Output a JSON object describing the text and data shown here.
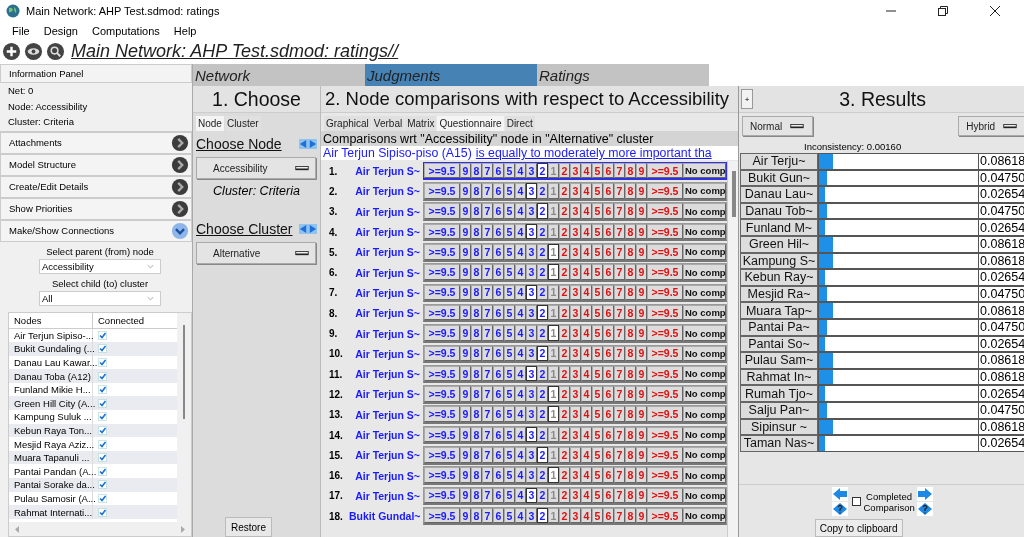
{
  "window": {
    "title": "Main Network: AHP Test.sdmod: ratings"
  },
  "menu": [
    "File",
    "Design",
    "Computations",
    "Help"
  ],
  "toolbar": {
    "title": "Main Network: AHP Test.sdmod: ratings//"
  },
  "info_panel": {
    "title": "Information Panel",
    "lines": [
      "Net: 0",
      "Node: Accessibility",
      "Cluster: Criteria"
    ]
  },
  "accordion": [
    {
      "label": "Attachments",
      "expanded": false
    },
    {
      "label": "Model Structure",
      "expanded": false
    },
    {
      "label": "Create/Edit Details",
      "expanded": false
    },
    {
      "label": "Show Priorities",
      "expanded": false
    },
    {
      "label": "Make/Show Connections",
      "expanded": true
    }
  ],
  "connections": {
    "parent_label": "Select parent (from) node",
    "parent_value": "Accessibility",
    "child_label": "Select child (to) cluster",
    "child_value": "All",
    "columns": [
      "Nodes",
      "Connected"
    ],
    "rows": [
      {
        "name": "Air Terjun Sipiso-...",
        "checked": true
      },
      {
        "name": "Bukit Gundaling (...",
        "checked": true
      },
      {
        "name": "Danau Lau Kawar...",
        "checked": true
      },
      {
        "name": "Danau Toba (A12)",
        "checked": true
      },
      {
        "name": "Funland Mikie H...",
        "checked": true
      },
      {
        "name": "Green Hill City (A...",
        "checked": true
      },
      {
        "name": "Kampung Suluk ...",
        "checked": true
      },
      {
        "name": "Kebun Raya Ton...",
        "checked": true
      },
      {
        "name": "Mesjid Raya Aziz...",
        "checked": true
      },
      {
        "name": "Muara Tapanuli ...",
        "checked": true
      },
      {
        "name": "Pantai Pandan (A...",
        "checked": true
      },
      {
        "name": "Pantai Sorake da...",
        "checked": true
      },
      {
        "name": "Pulau Samosir (A...",
        "checked": true
      },
      {
        "name": "Rahmat Internati...",
        "checked": true
      }
    ]
  },
  "tabs": [
    {
      "label": "Network",
      "selected": false
    },
    {
      "label": "Judgments",
      "selected": true
    },
    {
      "label": "Ratings",
      "selected": false
    }
  ],
  "choose": {
    "header": "1. Choose",
    "subtabs": [
      {
        "label": "Node",
        "selected": true
      },
      {
        "label": "Cluster",
        "selected": false
      }
    ],
    "node_title": "Choose Node",
    "node_value": "Accessibility",
    "cluster_caption": "Cluster: Criteria",
    "cluster_title": "Choose Cluster",
    "cluster_value": "Alternative",
    "restore": "Restore"
  },
  "comparisons": {
    "header": "2. Node comparisons with respect to Accessibility",
    "modes": [
      {
        "label": "Graphical",
        "selected": false
      },
      {
        "label": "Verbal",
        "selected": false
      },
      {
        "label": "Matrix",
        "selected": false
      },
      {
        "label": "Questionnaire",
        "selected": true
      },
      {
        "label": "Direct",
        "selected": false
      }
    ],
    "context": "Comparisons wrt \"Accessibility\" node in \"Alternative\" cluster",
    "statement_subject": "Air Terjun Sipiso-piso (A15)",
    "statement_link": "is equally to moderately more important tha",
    "rows": [
      {
        "number": "1.",
        "name": "Air Terjun S~",
        "focused": true,
        "left": [
          {
            "label": ">=9.5",
            "selected": false
          },
          {
            "label": "9",
            "selected": false
          },
          {
            "label": "8",
            "selected": false
          },
          {
            "label": "7",
            "selected": false
          },
          {
            "label": "6",
            "selected": false
          },
          {
            "label": "5",
            "selected": false
          },
          {
            "label": "4",
            "selected": false
          },
          {
            "label": "3",
            "selected": false
          },
          {
            "label": "2",
            "selected": true
          }
        ],
        "equal": {
          "label": "1",
          "selected": false
        },
        "right": [
          {
            "label": "2",
            "selected": false
          },
          {
            "label": "3",
            "selected": false
          },
          {
            "label": "4",
            "selected": false
          },
          {
            "label": "5",
            "selected": false
          },
          {
            "label": "6",
            "selected": false
          },
          {
            "label": "7",
            "selected": false
          },
          {
            "label": "8",
            "selected": false
          },
          {
            "label": "9",
            "selected": false
          },
          {
            "label": ">=9.5",
            "selected": false
          }
        ],
        "no_comparison": "No comp"
      },
      {
        "number": "2.",
        "name": "Air Terjun S~",
        "focused": false,
        "left": [
          {
            "label": ">=9.5",
            "selected": false
          },
          {
            "label": "9",
            "selected": false
          },
          {
            "label": "8",
            "selected": false
          },
          {
            "label": "7",
            "selected": false
          },
          {
            "label": "6",
            "selected": false
          },
          {
            "label": "5",
            "selected": false
          },
          {
            "label": "4",
            "selected": false
          },
          {
            "label": "3",
            "selected": true
          },
          {
            "label": "2",
            "selected": false
          }
        ],
        "equal": {
          "label": "1",
          "selected": false
        },
        "right": [
          {
            "label": "2",
            "selected": false
          },
          {
            "label": "3",
            "selected": false
          },
          {
            "label": "4",
            "selected": false
          },
          {
            "label": "5",
            "selected": false
          },
          {
            "label": "6",
            "selected": false
          },
          {
            "label": "7",
            "selected": false
          },
          {
            "label": "8",
            "selected": false
          },
          {
            "label": "9",
            "selected": false
          },
          {
            "label": ">=9.5",
            "selected": false
          }
        ],
        "no_comparison": "No comp"
      },
      {
        "number": "3.",
        "name": "Air Terjun S~",
        "focused": false,
        "left": [
          {
            "label": ">=9.5",
            "selected": false
          },
          {
            "label": "9",
            "selected": false
          },
          {
            "label": "8",
            "selected": false
          },
          {
            "label": "7",
            "selected": false
          },
          {
            "label": "6",
            "selected": false
          },
          {
            "label": "5",
            "selected": false
          },
          {
            "label": "4",
            "selected": false
          },
          {
            "label": "3",
            "selected": false
          },
          {
            "label": "2",
            "selected": true
          }
        ],
        "equal": {
          "label": "1",
          "selected": false
        },
        "right": [
          {
            "label": "2",
            "selected": false
          },
          {
            "label": "3",
            "selected": false
          },
          {
            "label": "4",
            "selected": false
          },
          {
            "label": "5",
            "selected": false
          },
          {
            "label": "6",
            "selected": false
          },
          {
            "label": "7",
            "selected": false
          },
          {
            "label": "8",
            "selected": false
          },
          {
            "label": "9",
            "selected": false
          },
          {
            "label": ">=9.5",
            "selected": false
          }
        ],
        "no_comparison": "No comp"
      },
      {
        "number": "4.",
        "name": "Air Terjun S~",
        "focused": false,
        "left": [
          {
            "label": ">=9.5",
            "selected": false
          },
          {
            "label": "9",
            "selected": false
          },
          {
            "label": "8",
            "selected": false
          },
          {
            "label": "7",
            "selected": false
          },
          {
            "label": "6",
            "selected": false
          },
          {
            "label": "5",
            "selected": false
          },
          {
            "label": "4",
            "selected": false
          },
          {
            "label": "3",
            "selected": true
          },
          {
            "label": "2",
            "selected": false
          }
        ],
        "equal": {
          "label": "1",
          "selected": false
        },
        "right": [
          {
            "label": "2",
            "selected": false
          },
          {
            "label": "3",
            "selected": false
          },
          {
            "label": "4",
            "selected": false
          },
          {
            "label": "5",
            "selected": false
          },
          {
            "label": "6",
            "selected": false
          },
          {
            "label": "7",
            "selected": false
          },
          {
            "label": "8",
            "selected": false
          },
          {
            "label": "9",
            "selected": false
          },
          {
            "label": ">=9.5",
            "selected": false
          }
        ],
        "no_comparison": "No comp"
      },
      {
        "number": "5.",
        "name": "Air Terjun S~",
        "focused": false,
        "left": [
          {
            "label": ">=9.5",
            "selected": false
          },
          {
            "label": "9",
            "selected": false
          },
          {
            "label": "8",
            "selected": false
          },
          {
            "label": "7",
            "selected": false
          },
          {
            "label": "6",
            "selected": false
          },
          {
            "label": "5",
            "selected": false
          },
          {
            "label": "4",
            "selected": false
          },
          {
            "label": "3",
            "selected": false
          },
          {
            "label": "2",
            "selected": false
          }
        ],
        "equal": {
          "label": "1",
          "selected": true
        },
        "right": [
          {
            "label": "2",
            "selected": false
          },
          {
            "label": "3",
            "selected": false
          },
          {
            "label": "4",
            "selected": false
          },
          {
            "label": "5",
            "selected": false
          },
          {
            "label": "6",
            "selected": false
          },
          {
            "label": "7",
            "selected": false
          },
          {
            "label": "8",
            "selected": false
          },
          {
            "label": "9",
            "selected": false
          },
          {
            "label": ">=9.5",
            "selected": false
          }
        ],
        "no_comparison": "No comp"
      },
      {
        "number": "6.",
        "name": "Air Terjun S~",
        "focused": false,
        "left": [
          {
            "label": ">=9.5",
            "selected": false
          },
          {
            "label": "9",
            "selected": false
          },
          {
            "label": "8",
            "selected": false
          },
          {
            "label": "7",
            "selected": false
          },
          {
            "label": "6",
            "selected": false
          },
          {
            "label": "5",
            "selected": false
          },
          {
            "label": "4",
            "selected": false
          },
          {
            "label": "3",
            "selected": false
          },
          {
            "label": "2",
            "selected": false
          }
        ],
        "equal": {
          "label": "1",
          "selected": true
        },
        "right": [
          {
            "label": "2",
            "selected": false
          },
          {
            "label": "3",
            "selected": false
          },
          {
            "label": "4",
            "selected": false
          },
          {
            "label": "5",
            "selected": false
          },
          {
            "label": "6",
            "selected": false
          },
          {
            "label": "7",
            "selected": false
          },
          {
            "label": "8",
            "selected": false
          },
          {
            "label": "9",
            "selected": false
          },
          {
            "label": ">=9.5",
            "selected": false
          }
        ],
        "no_comparison": "No comp"
      },
      {
        "number": "7.",
        "name": "Air Terjun S~",
        "focused": false,
        "left": [
          {
            "label": ">=9.5",
            "selected": false
          },
          {
            "label": "9",
            "selected": false
          },
          {
            "label": "8",
            "selected": false
          },
          {
            "label": "7",
            "selected": false
          },
          {
            "label": "6",
            "selected": false
          },
          {
            "label": "5",
            "selected": false
          },
          {
            "label": "4",
            "selected": false
          },
          {
            "label": "3",
            "selected": true
          },
          {
            "label": "2",
            "selected": false
          }
        ],
        "equal": {
          "label": "1",
          "selected": false
        },
        "right": [
          {
            "label": "2",
            "selected": false
          },
          {
            "label": "3",
            "selected": false
          },
          {
            "label": "4",
            "selected": false
          },
          {
            "label": "5",
            "selected": false
          },
          {
            "label": "6",
            "selected": false
          },
          {
            "label": "7",
            "selected": false
          },
          {
            "label": "8",
            "selected": false
          },
          {
            "label": "9",
            "selected": false
          },
          {
            "label": ">=9.5",
            "selected": false
          }
        ],
        "no_comparison": "No comp"
      },
      {
        "number": "8.",
        "name": "Air Terjun S~",
        "focused": false,
        "left": [
          {
            "label": ">=9.5",
            "selected": false
          },
          {
            "label": "9",
            "selected": false
          },
          {
            "label": "8",
            "selected": false
          },
          {
            "label": "7",
            "selected": false
          },
          {
            "label": "6",
            "selected": false
          },
          {
            "label": "5",
            "selected": false
          },
          {
            "label": "4",
            "selected": false
          },
          {
            "label": "3",
            "selected": false
          },
          {
            "label": "2",
            "selected": true
          }
        ],
        "equal": {
          "label": "1",
          "selected": false
        },
        "right": [
          {
            "label": "2",
            "selected": false
          },
          {
            "label": "3",
            "selected": false
          },
          {
            "label": "4",
            "selected": false
          },
          {
            "label": "5",
            "selected": false
          },
          {
            "label": "6",
            "selected": false
          },
          {
            "label": "7",
            "selected": false
          },
          {
            "label": "8",
            "selected": false
          },
          {
            "label": "9",
            "selected": false
          },
          {
            "label": ">=9.5",
            "selected": false
          }
        ],
        "no_comparison": "No comp"
      },
      {
        "number": "9.",
        "name": "Air Terjun S~",
        "focused": false,
        "left": [
          {
            "label": ">=9.5",
            "selected": false
          },
          {
            "label": "9",
            "selected": false
          },
          {
            "label": "8",
            "selected": false
          },
          {
            "label": "7",
            "selected": false
          },
          {
            "label": "6",
            "selected": false
          },
          {
            "label": "5",
            "selected": false
          },
          {
            "label": "4",
            "selected": false
          },
          {
            "label": "3",
            "selected": false
          },
          {
            "label": "2",
            "selected": false
          }
        ],
        "equal": {
          "label": "1",
          "selected": true
        },
        "right": [
          {
            "label": "2",
            "selected": false
          },
          {
            "label": "3",
            "selected": false
          },
          {
            "label": "4",
            "selected": false
          },
          {
            "label": "5",
            "selected": false
          },
          {
            "label": "6",
            "selected": false
          },
          {
            "label": "7",
            "selected": false
          },
          {
            "label": "8",
            "selected": false
          },
          {
            "label": "9",
            "selected": false
          },
          {
            "label": ">=9.5",
            "selected": false
          }
        ],
        "no_comparison": "No comp"
      },
      {
        "number": "10.",
        "name": "Air Terjun S~",
        "focused": false,
        "left": [
          {
            "label": ">=9.5",
            "selected": false
          },
          {
            "label": "9",
            "selected": false
          },
          {
            "label": "8",
            "selected": false
          },
          {
            "label": "7",
            "selected": false
          },
          {
            "label": "6",
            "selected": false
          },
          {
            "label": "5",
            "selected": false
          },
          {
            "label": "4",
            "selected": false
          },
          {
            "label": "3",
            "selected": false
          },
          {
            "label": "2",
            "selected": true
          }
        ],
        "equal": {
          "label": "1",
          "selected": false
        },
        "right": [
          {
            "label": "2",
            "selected": false
          },
          {
            "label": "3",
            "selected": false
          },
          {
            "label": "4",
            "selected": false
          },
          {
            "label": "5",
            "selected": false
          },
          {
            "label": "6",
            "selected": false
          },
          {
            "label": "7",
            "selected": false
          },
          {
            "label": "8",
            "selected": false
          },
          {
            "label": "9",
            "selected": false
          },
          {
            "label": ">=9.5",
            "selected": false
          }
        ],
        "no_comparison": "No comp"
      },
      {
        "number": "11.",
        "name": "Air Terjun S~",
        "focused": false,
        "left": [
          {
            "label": ">=9.5",
            "selected": false
          },
          {
            "label": "9",
            "selected": false
          },
          {
            "label": "8",
            "selected": false
          },
          {
            "label": "7",
            "selected": false
          },
          {
            "label": "6",
            "selected": false
          },
          {
            "label": "5",
            "selected": false
          },
          {
            "label": "4",
            "selected": false
          },
          {
            "label": "3",
            "selected": true
          },
          {
            "label": "2",
            "selected": false
          }
        ],
        "equal": {
          "label": "1",
          "selected": false
        },
        "right": [
          {
            "label": "2",
            "selected": false
          },
          {
            "label": "3",
            "selected": false
          },
          {
            "label": "4",
            "selected": false
          },
          {
            "label": "5",
            "selected": false
          },
          {
            "label": "6",
            "selected": false
          },
          {
            "label": "7",
            "selected": false
          },
          {
            "label": "8",
            "selected": false
          },
          {
            "label": "9",
            "selected": false
          },
          {
            "label": ">=9.5",
            "selected": false
          }
        ],
        "no_comparison": "No comp"
      },
      {
        "number": "12.",
        "name": "Air Terjun S~",
        "focused": false,
        "left": [
          {
            "label": ">=9.5",
            "selected": false
          },
          {
            "label": "9",
            "selected": false
          },
          {
            "label": "8",
            "selected": false
          },
          {
            "label": "7",
            "selected": false
          },
          {
            "label": "6",
            "selected": false
          },
          {
            "label": "5",
            "selected": false
          },
          {
            "label": "4",
            "selected": false
          },
          {
            "label": "3",
            "selected": false
          },
          {
            "label": "2",
            "selected": false
          }
        ],
        "equal": {
          "label": "1",
          "selected": true
        },
        "right": [
          {
            "label": "2",
            "selected": false
          },
          {
            "label": "3",
            "selected": false
          },
          {
            "label": "4",
            "selected": false
          },
          {
            "label": "5",
            "selected": false
          },
          {
            "label": "6",
            "selected": false
          },
          {
            "label": "7",
            "selected": false
          },
          {
            "label": "8",
            "selected": false
          },
          {
            "label": "9",
            "selected": false
          },
          {
            "label": ">=9.5",
            "selected": false
          }
        ],
        "no_comparison": "No comp"
      },
      {
        "number": "13.",
        "name": "Air Terjun S~",
        "focused": false,
        "left": [
          {
            "label": ">=9.5",
            "selected": false
          },
          {
            "label": "9",
            "selected": false
          },
          {
            "label": "8",
            "selected": false
          },
          {
            "label": "7",
            "selected": false
          },
          {
            "label": "6",
            "selected": false
          },
          {
            "label": "5",
            "selected": false
          },
          {
            "label": "4",
            "selected": false
          },
          {
            "label": "3",
            "selected": false
          },
          {
            "label": "2",
            "selected": false
          }
        ],
        "equal": {
          "label": "1",
          "selected": true
        },
        "right": [
          {
            "label": "2",
            "selected": false
          },
          {
            "label": "3",
            "selected": false
          },
          {
            "label": "4",
            "selected": false
          },
          {
            "label": "5",
            "selected": false
          },
          {
            "label": "6",
            "selected": false
          },
          {
            "label": "7",
            "selected": false
          },
          {
            "label": "8",
            "selected": false
          },
          {
            "label": "9",
            "selected": false
          },
          {
            "label": ">=9.5",
            "selected": false
          }
        ],
        "no_comparison": "No comp"
      },
      {
        "number": "14.",
        "name": "Air Terjun S~",
        "focused": false,
        "left": [
          {
            "label": ">=9.5",
            "selected": false
          },
          {
            "label": "9",
            "selected": false
          },
          {
            "label": "8",
            "selected": false
          },
          {
            "label": "7",
            "selected": false
          },
          {
            "label": "6",
            "selected": false
          },
          {
            "label": "5",
            "selected": false
          },
          {
            "label": "4",
            "selected": false
          },
          {
            "label": "3",
            "selected": true
          },
          {
            "label": "2",
            "selected": false
          }
        ],
        "equal": {
          "label": "1",
          "selected": false
        },
        "right": [
          {
            "label": "2",
            "selected": false
          },
          {
            "label": "3",
            "selected": false
          },
          {
            "label": "4",
            "selected": false
          },
          {
            "label": "5",
            "selected": false
          },
          {
            "label": "6",
            "selected": false
          },
          {
            "label": "7",
            "selected": false
          },
          {
            "label": "8",
            "selected": false
          },
          {
            "label": "9",
            "selected": false
          },
          {
            "label": ">=9.5",
            "selected": false
          }
        ],
        "no_comparison": "No comp"
      },
      {
        "number": "15.",
        "name": "Air Terjun S~",
        "focused": false,
        "left": [
          {
            "label": ">=9.5",
            "selected": false
          },
          {
            "label": "9",
            "selected": false
          },
          {
            "label": "8",
            "selected": false
          },
          {
            "label": "7",
            "selected": false
          },
          {
            "label": "6",
            "selected": false
          },
          {
            "label": "5",
            "selected": false
          },
          {
            "label": "4",
            "selected": false
          },
          {
            "label": "3",
            "selected": false
          },
          {
            "label": "2",
            "selected": true
          }
        ],
        "equal": {
          "label": "1",
          "selected": false
        },
        "right": [
          {
            "label": "2",
            "selected": false
          },
          {
            "label": "3",
            "selected": false
          },
          {
            "label": "4",
            "selected": false
          },
          {
            "label": "5",
            "selected": false
          },
          {
            "label": "6",
            "selected": false
          },
          {
            "label": "7",
            "selected": false
          },
          {
            "label": "8",
            "selected": false
          },
          {
            "label": "9",
            "selected": false
          },
          {
            "label": ">=9.5",
            "selected": false
          }
        ],
        "no_comparison": "No comp"
      },
      {
        "number": "16.",
        "name": "Air Terjun S~",
        "focused": false,
        "left": [
          {
            "label": ">=9.5",
            "selected": false
          },
          {
            "label": "9",
            "selected": false
          },
          {
            "label": "8",
            "selected": false
          },
          {
            "label": "7",
            "selected": false
          },
          {
            "label": "6",
            "selected": false
          },
          {
            "label": "5",
            "selected": false
          },
          {
            "label": "4",
            "selected": false
          },
          {
            "label": "3",
            "selected": false
          },
          {
            "label": "2",
            "selected": false
          }
        ],
        "equal": {
          "label": "1",
          "selected": true
        },
        "right": [
          {
            "label": "2",
            "selected": false
          },
          {
            "label": "3",
            "selected": false
          },
          {
            "label": "4",
            "selected": false
          },
          {
            "label": "5",
            "selected": false
          },
          {
            "label": "6",
            "selected": false
          },
          {
            "label": "7",
            "selected": false
          },
          {
            "label": "8",
            "selected": false
          },
          {
            "label": "9",
            "selected": false
          },
          {
            "label": ">=9.5",
            "selected": false
          }
        ],
        "no_comparison": "No comp"
      },
      {
        "number": "17.",
        "name": "Air Terjun S~",
        "focused": false,
        "left": [
          {
            "label": ">=9.5",
            "selected": false
          },
          {
            "label": "9",
            "selected": false
          },
          {
            "label": "8",
            "selected": false
          },
          {
            "label": "7",
            "selected": false
          },
          {
            "label": "6",
            "selected": false
          },
          {
            "label": "5",
            "selected": false
          },
          {
            "label": "4",
            "selected": false
          },
          {
            "label": "3",
            "selected": true
          },
          {
            "label": "2",
            "selected": false
          }
        ],
        "equal": {
          "label": "1",
          "selected": false
        },
        "right": [
          {
            "label": "2",
            "selected": false
          },
          {
            "label": "3",
            "selected": false
          },
          {
            "label": "4",
            "selected": false
          },
          {
            "label": "5",
            "selected": false
          },
          {
            "label": "6",
            "selected": false
          },
          {
            "label": "7",
            "selected": false
          },
          {
            "label": "8",
            "selected": false
          },
          {
            "label": "9",
            "selected": false
          },
          {
            "label": ">=9.5",
            "selected": false
          }
        ],
        "no_comparison": "No comp"
      },
      {
        "number": "18.",
        "name": "Bukit Gundal~",
        "focused": false,
        "left": [
          {
            "label": ">=9.5",
            "selected": false
          },
          {
            "label": "9",
            "selected": false
          },
          {
            "label": "8",
            "selected": false
          },
          {
            "label": "7",
            "selected": false
          },
          {
            "label": "6",
            "selected": false
          },
          {
            "label": "5",
            "selected": false
          },
          {
            "label": "4",
            "selected": false
          },
          {
            "label": "3",
            "selected": false
          },
          {
            "label": "2",
            "selected": true
          }
        ],
        "equal": {
          "label": "1",
          "selected": false
        },
        "right": [
          {
            "label": "2",
            "selected": false
          },
          {
            "label": "3",
            "selected": false
          },
          {
            "label": "4",
            "selected": false
          },
          {
            "label": "5",
            "selected": false
          },
          {
            "label": "6",
            "selected": false
          },
          {
            "label": "7",
            "selected": false
          },
          {
            "label": "8",
            "selected": false
          },
          {
            "label": "9",
            "selected": false
          },
          {
            "label": ">=9.5",
            "selected": false
          }
        ],
        "no_comparison": "No comp"
      }
    ]
  },
  "results": {
    "header": "3. Results",
    "expand_button": "+",
    "view_value": "Normal",
    "mode_value": "Hybrid",
    "inconsistency": "Inconsistency: 0.00160",
    "rows": [
      {
        "name": "Air Terju~",
        "level": 0.08618,
        "value": "0.08618"
      },
      {
        "name": "Bukit Gun~",
        "level": 0.0475,
        "value": "0.04750"
      },
      {
        "name": "Danau Lau~",
        "level": 0.02654,
        "value": "0.02654"
      },
      {
        "name": "Danau Tob~",
        "level": 0.0475,
        "value": "0.04750"
      },
      {
        "name": "Funland M~",
        "level": 0.02654,
        "value": "0.02654"
      },
      {
        "name": "Green Hil~",
        "level": 0.08618,
        "value": "0.08618"
      },
      {
        "name": "Kampung S~",
        "level": 0.08618,
        "value": "0.08618"
      },
      {
        "name": "Kebun Ray~",
        "level": 0.02654,
        "value": "0.02654"
      },
      {
        "name": "Mesjid Ra~",
        "level": 0.0475,
        "value": "0.04750"
      },
      {
        "name": "Muara Tap~",
        "level": 0.08618,
        "value": "0.08618"
      },
      {
        "name": "Pantai Pa~",
        "level": 0.0475,
        "value": "0.04750"
      },
      {
        "name": "Pantai So~",
        "level": 0.02654,
        "value": "0.02654"
      },
      {
        "name": "Pulau Sam~",
        "level": 0.08618,
        "value": "0.08618"
      },
      {
        "name": "Rahmat In~",
        "level": 0.08618,
        "value": "0.08618"
      },
      {
        "name": "Rumah Tjo~",
        "level": 0.02654,
        "value": "0.02654"
      },
      {
        "name": "Salju Pan~",
        "level": 0.0475,
        "value": "0.04750"
      },
      {
        "name": "Sipinsur ~",
        "level": 0.08618,
        "value": "0.08618"
      },
      {
        "name": "Taman Nas~",
        "level": 0.02654,
        "value": "0.02654"
      }
    ],
    "completed": {
      "label_1": "Completed",
      "label_2": "Comparison",
      "checked": false
    },
    "copy_button": "Copy to clipboard"
  }
}
